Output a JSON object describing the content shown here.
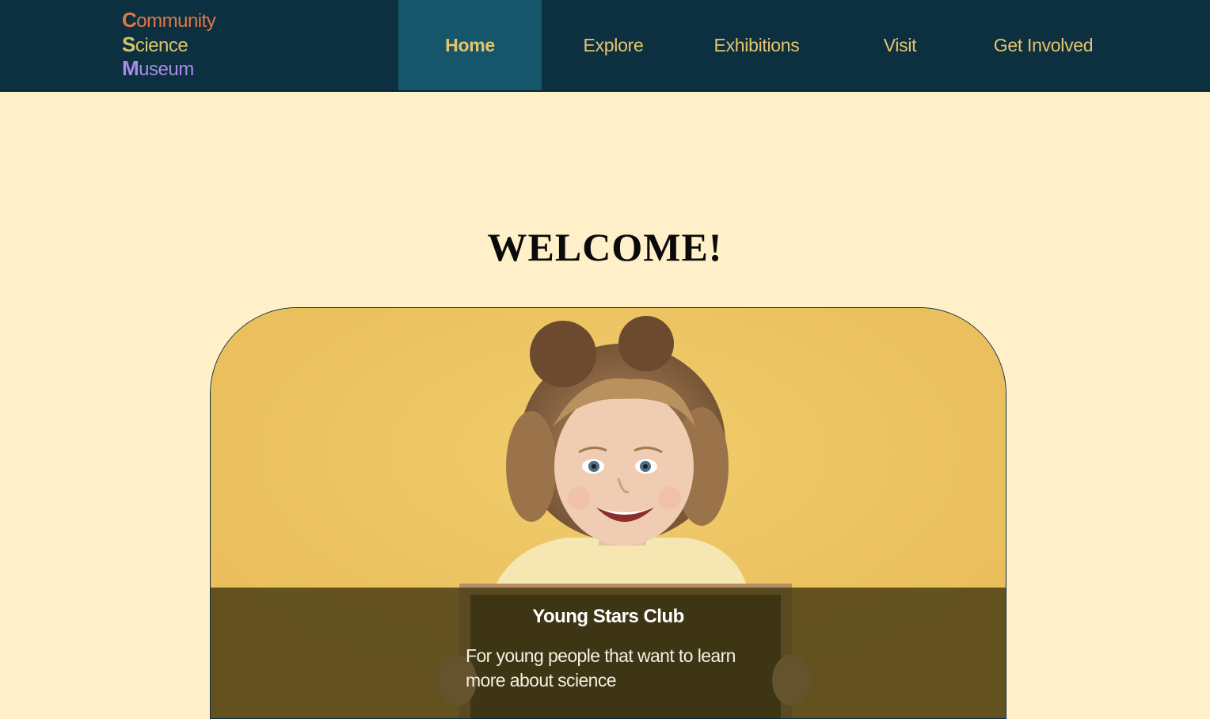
{
  "header": {
    "logo": {
      "line1_initial": "C",
      "line1_rest": "ommunity",
      "line2_initial": "S",
      "line2_rest": "cience",
      "line3_initial": "M",
      "line3_rest": "useum"
    },
    "nav": [
      {
        "label": "Home",
        "active": true
      },
      {
        "label": "Explore"
      },
      {
        "label": "Exhibitions"
      },
      {
        "label": "Visit"
      },
      {
        "label": "Get Involved"
      }
    ]
  },
  "main": {
    "heading": "WELCOME!",
    "hero": {
      "card_title": "Young Stars Club",
      "card_description": "For young people that want to learn more about science"
    }
  },
  "colors": {
    "nav_bg": "#0c3040",
    "nav_active_bg": "#16566b",
    "nav_text": "#e6c46d",
    "page_bg": "#fff0c9",
    "logo_c": "#e0764a",
    "logo_s": "#d6c46a",
    "logo_m": "#a98be8",
    "hero_bg": "#ecc362"
  }
}
